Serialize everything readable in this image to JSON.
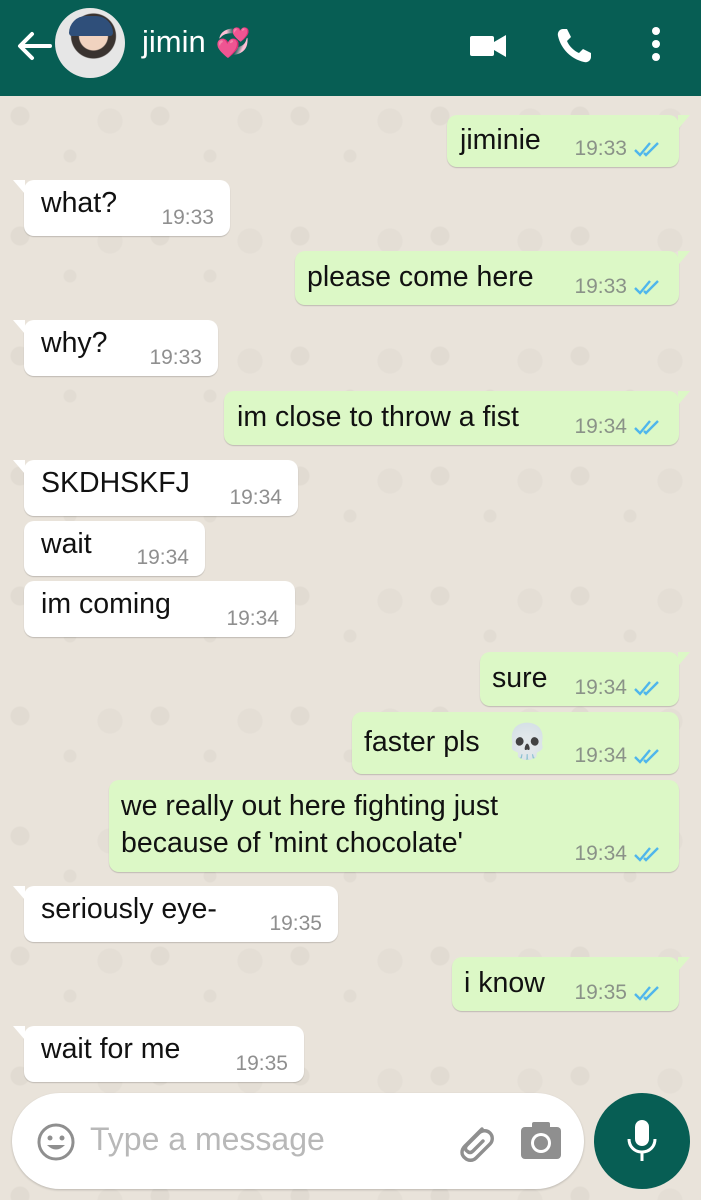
{
  "header": {
    "contact_name": "jimin",
    "contact_emoji": "💞"
  },
  "messages": [
    {
      "dir": "out",
      "text": "jiminie",
      "time": "19:33",
      "read": true
    },
    {
      "dir": "in",
      "text": "what?",
      "time": "19:33"
    },
    {
      "dir": "out",
      "text": "please come here",
      "time": "19:33",
      "read": true
    },
    {
      "dir": "in",
      "text": "why?",
      "time": "19:33"
    },
    {
      "dir": "out",
      "text": "im close to throw a fist",
      "time": "19:34",
      "read": true
    },
    {
      "dir": "in",
      "text": "SKDHSKFJ",
      "time": "19:34"
    },
    {
      "dir": "in",
      "text": "wait",
      "time": "19:34"
    },
    {
      "dir": "in",
      "text": "im coming",
      "time": "19:34"
    },
    {
      "dir": "out",
      "text": "sure",
      "time": "19:34",
      "read": true
    },
    {
      "dir": "out",
      "text": "faster pls",
      "emoji": "💀",
      "time": "19:34",
      "read": true
    },
    {
      "dir": "out",
      "line1": "we really out here fighting just",
      "line2": "because of 'mint chocolate'",
      "time": "19:34",
      "read": true
    },
    {
      "dir": "in",
      "text": "seriously eye-",
      "time": "19:35"
    },
    {
      "dir": "out",
      "text": "i know",
      "time": "19:35",
      "read": true
    },
    {
      "dir": "in",
      "text": "wait for me",
      "time": "19:35"
    }
  ],
  "composer": {
    "placeholder": "Type a message"
  },
  "icons": {
    "back": "back-arrow-icon",
    "video": "video-call-icon",
    "call": "phone-icon",
    "menu": "more-vert-icon",
    "emoji": "emoji-icon",
    "attach": "paperclip-icon",
    "camera": "camera-icon",
    "mic": "microphone-icon",
    "read": "double-check-icon"
  },
  "colors": {
    "header": "#075e54",
    "outgoing": "#dcf8c6",
    "incoming": "#ffffff",
    "read_tick": "#4fb6ec"
  }
}
